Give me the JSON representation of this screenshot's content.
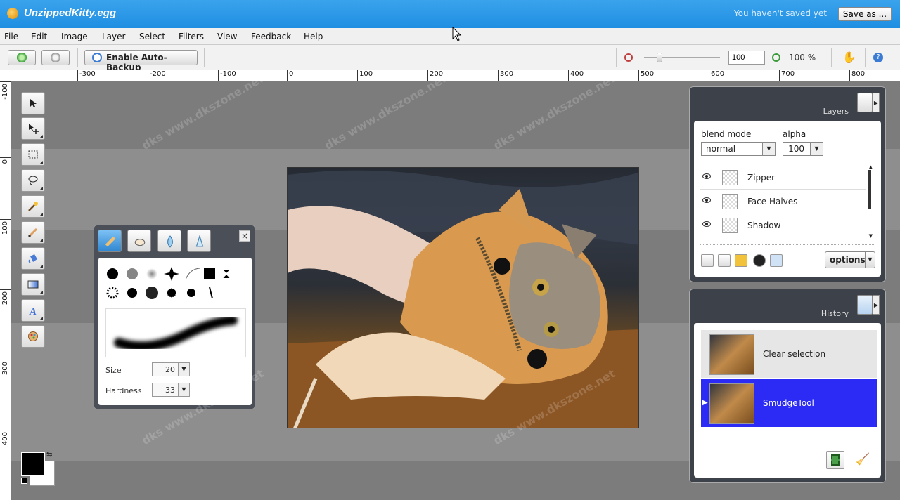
{
  "window": {
    "title": "UnzippedKitty.egg",
    "save_status": "You haven't saved yet",
    "save_button": "Save as ..."
  },
  "menu": [
    "File",
    "Edit",
    "Image",
    "Layer",
    "Select",
    "Filters",
    "View",
    "Feedback",
    "Help"
  ],
  "toolbar": {
    "backup_label": "Enable Auto-Backup",
    "zoom_value": "100",
    "zoom_percent": "100 %"
  },
  "ruler": {
    "horizontal": [
      "-300",
      "-200",
      "-100",
      "0",
      "100",
      "200",
      "300",
      "400",
      "500",
      "600",
      "700",
      "800"
    ],
    "vertical": [
      "-100",
      "0",
      "100",
      "200",
      "300",
      "400"
    ]
  },
  "tools": [
    "pointer-icon",
    "move-icon",
    "marquee-icon",
    "lasso-icon",
    "magic-wand-icon",
    "brush-icon",
    "bucket-icon",
    "gradient-icon",
    "text-icon",
    "smudge-icon"
  ],
  "brush_panel": {
    "close": "×",
    "size_label": "Size",
    "size_value": "20",
    "hardness_label": "Hardness",
    "hardness_value": "33"
  },
  "layers_panel": {
    "title": "Layers",
    "blend_mode_label": "blend mode",
    "blend_mode_value": "normal",
    "alpha_label": "alpha",
    "alpha_value": "100",
    "layers": [
      {
        "name": "Zipper"
      },
      {
        "name": "Face Halves"
      },
      {
        "name": "Shadow"
      }
    ],
    "options_label": "options"
  },
  "history_panel": {
    "title": "History",
    "items": [
      {
        "label": "Clear selection",
        "selected": false
      },
      {
        "label": "SmudgeTool",
        "selected": true
      }
    ]
  },
  "colors": {
    "title_bar": "#1f8ee2",
    "selection": "#2b2bf5",
    "foreground": "#000000",
    "background": "#ffffff"
  }
}
